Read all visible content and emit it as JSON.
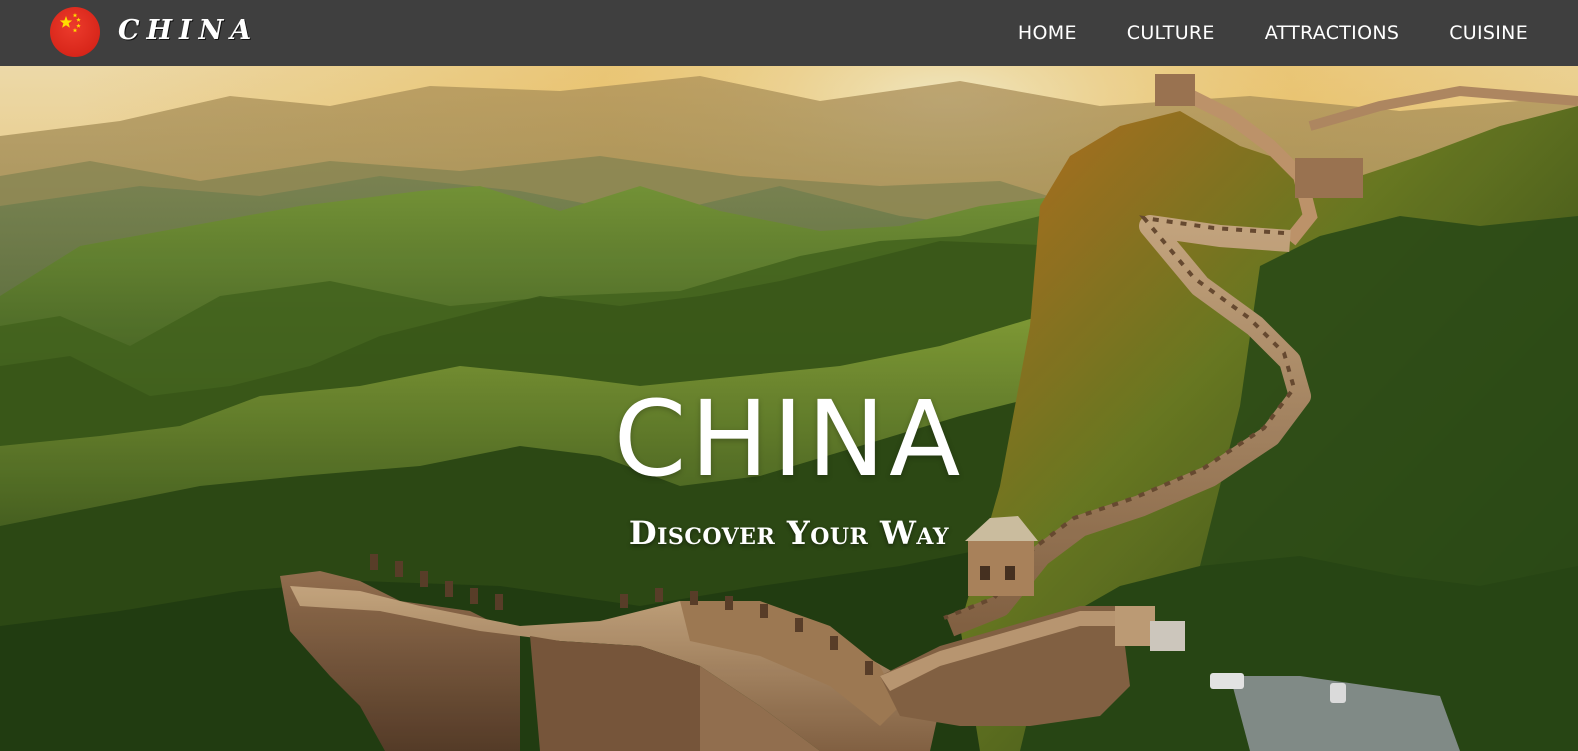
{
  "brand": {
    "logo_icon": "china-flag-icon",
    "name": "CHINA"
  },
  "nav": {
    "items": [
      {
        "label": "HOME"
      },
      {
        "label": "CULTURE"
      },
      {
        "label": "ATTRACTIONS"
      },
      {
        "label": "CUISINE"
      }
    ]
  },
  "hero": {
    "title": "CHINA",
    "subtitle": "Discover Your Way",
    "image_subject": "great-wall-landscape"
  },
  "colors": {
    "nav_bg": "#3f3f3f",
    "flag_red": "#de2910",
    "flag_star": "#ffde00",
    "text": "#ffffff"
  }
}
